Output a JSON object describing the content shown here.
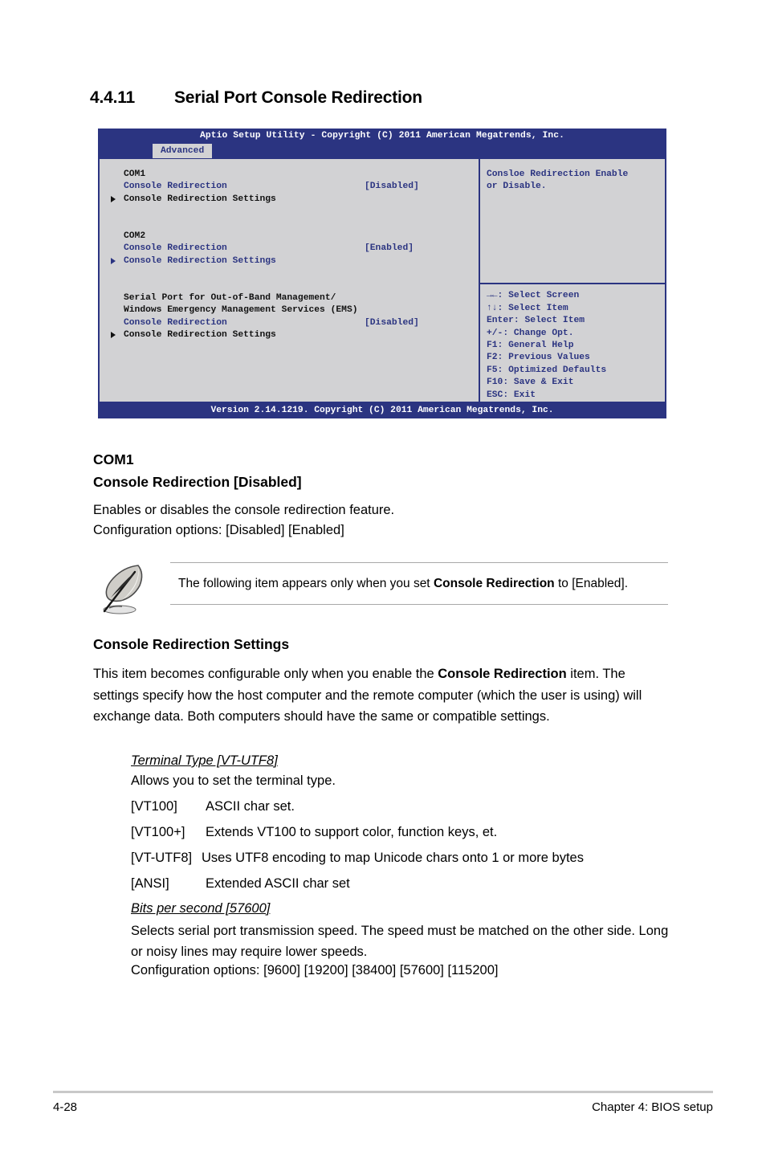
{
  "section": {
    "number": "4.4.11",
    "title": "Serial Port Console Redirection"
  },
  "bios": {
    "title_bar": "Aptio Setup Utility - Copyright (C) 2011 American Megatrends, Inc.",
    "active_tab": "Advanced",
    "version_bar": "Version 2.14.1219. Copyright (C) 2011 American Megatrends, Inc.",
    "groups": [
      {
        "heading": "COM1",
        "redirection_label": "Console Redirection",
        "redirection_value": "[Disabled]",
        "settings_label": "Console Redirection Settings"
      },
      {
        "heading": "COM2",
        "redirection_label": "Console Redirection",
        "redirection_value": "[Enabled]",
        "settings_label": "Console Redirection Settings"
      },
      {
        "heading_line1": "Serial Port for Out-of-Band Management/",
        "heading_line2": "Windows Emergency Management Services (EMS)",
        "redirection_label": "Console Redirection",
        "redirection_value": "[Disabled]",
        "settings_label": "Console Redirection Settings"
      }
    ],
    "help": {
      "line1": "Consloe Redirection Enable",
      "line2": "or Disable."
    },
    "keys": [
      "→←: Select Screen",
      "↑↓:  Select Item",
      "Enter: Select Item",
      "+/-: Change Opt.",
      "F1: General Help",
      "F2: Previous Values",
      "F5: Optimized Defaults",
      "F10: Save & Exit",
      "ESC: Exit"
    ]
  },
  "com1": {
    "heading": "COM1",
    "subheading": "Console Redirection [Disabled]",
    "desc": "Enables or disables the console redirection feature.",
    "options": "Configuration options: [Disabled] [Enabled]"
  },
  "note": {
    "text_before": "The following item appears only when you set ",
    "bold": "Console Redirection",
    "text_after": " to [Enabled]."
  },
  "crs": {
    "heading": "Console Redirection Settings",
    "paragraph_before": "This item becomes configurable only when you enable the ",
    "paragraph_bold": "Console Redirection",
    "paragraph_after": " item. The settings specify how the host computer and the remote computer (which the user is using) will exchange data. Both computers should have the same or compatible settings."
  },
  "terminal_type": {
    "heading": "Terminal Type [VT-UTF8]",
    "desc": "Allows you to set the terminal type.",
    "options": [
      {
        "key": "[VT100]",
        "desc": "ASCII char set."
      },
      {
        "key": "[VT100+]",
        "desc": "Extends VT100 to support color, function keys, et."
      },
      {
        "key": "[VT-UTF8]",
        "desc": "Uses UTF8 encoding to map Unicode chars onto 1 or more bytes"
      },
      {
        "key": "[ANSI]",
        "desc": "Extended ASCII char set"
      }
    ]
  },
  "bits_per_second": {
    "heading": "Bits per second [57600]",
    "desc": "Selects serial port transmission speed. The speed must be matched on the other side. Long or noisy lines may require lower speeds.",
    "options": "Configuration options: [9600] [19200] [38400] [57600] [115200]"
  },
  "footer": {
    "page": "4-28",
    "chapter": "Chapter 4: BIOS setup"
  }
}
